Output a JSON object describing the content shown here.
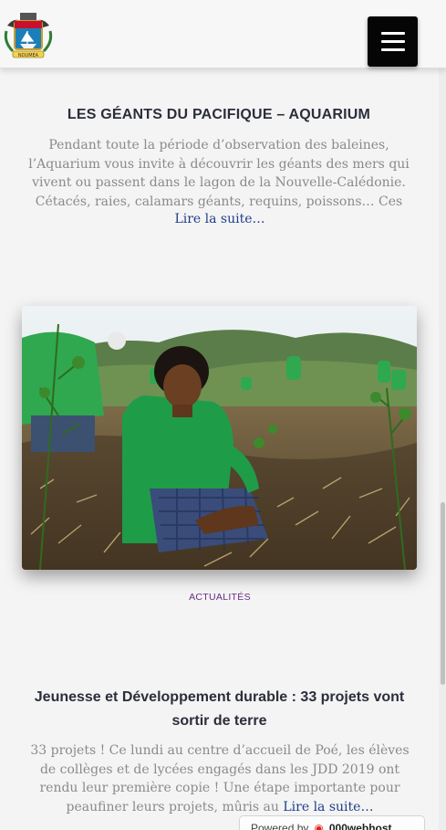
{
  "header": {
    "logo_text": "NOUMEA",
    "menu_icon": "hamburger-icon"
  },
  "article1": {
    "title": "LES GÉANTS DU PACIFIQUE – AQUARIUM",
    "excerpt": "Pendant toute la période d’observation des baleines, l’Aquarium vous invite à découvrir les géants des mers qui vivent ou passent dans le lagon de la Nouvelle-Calédonie. Cétacés, raies, calamars géants, requins, poissons… Ces espèces battent",
    "read_more": "Lire la suite…"
  },
  "article2": {
    "category": "ACTUALITÉS",
    "title": "Jeunesse et Développement durable : 33 projets vont sortir de terre",
    "excerpt": "33 projets ! Ce lundi au centre d’accueil de Poé, les élèves de collèges et de lycées engagés dans les JDD 2019 ont rendu leur première copie ! Une étape importante pour peaufiner leurs projets, mûris au",
    "read_more": "Lire la suite…"
  },
  "badge": {
    "powered": "Powered by",
    "brand": "000webhost"
  },
  "colors": {
    "accent_purple": "#6a2b82",
    "link_blue": "#1f3e87",
    "title_dark": "#2b2e3a"
  }
}
